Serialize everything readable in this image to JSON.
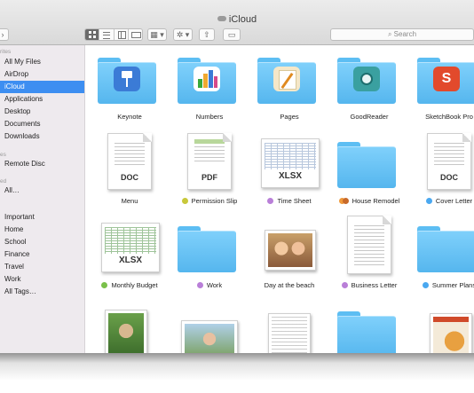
{
  "window": {
    "title": "iCloud"
  },
  "toolbar": {
    "search_placeholder": "Search"
  },
  "sidebar": {
    "favorites_heading": "rites",
    "favorites": [
      "All My Files",
      "AirDrop",
      "iCloud",
      "Applications",
      "Desktop",
      "Documents",
      "Downloads"
    ],
    "devices_heading": "es",
    "devices": [
      "Remote Disc"
    ],
    "shared_heading": "ed",
    "shared": [
      "All…"
    ],
    "tags_heading": "",
    "tags": [
      "Important",
      "Home",
      "School",
      "Finance",
      "Travel",
      "Work",
      "All Tags…"
    ],
    "selected": "iCloud"
  },
  "files": {
    "row1": [
      {
        "name": "Keynote",
        "kind": "folder",
        "app": "keynote",
        "color": "#3b7bd6"
      },
      {
        "name": "Numbers",
        "kind": "folder",
        "app": "numbers",
        "color": "#4caf50"
      },
      {
        "name": "Pages",
        "kind": "folder",
        "app": "pages",
        "color": "#f0a830"
      },
      {
        "name": "GoodReader",
        "kind": "folder",
        "app": "goodreader",
        "color": "#3aa0a0"
      },
      {
        "name": "SketchBook Pro",
        "kind": "folder",
        "app": "sketchbook",
        "color": "#e24a2c"
      }
    ],
    "row2": [
      {
        "name": "Menu",
        "kind": "doc",
        "type_label": "DOC",
        "tag": ""
      },
      {
        "name": "Permission Slip",
        "kind": "doc",
        "type_label": "PDF",
        "tag": "#c8c83a"
      },
      {
        "name": "Time Sheet",
        "kind": "sheet",
        "type_label": "XLSX",
        "tag": "#b97fd8"
      },
      {
        "name": "House Remodel",
        "kind": "folder",
        "tag": "#f09a3a",
        "tag2": "#e88a2a"
      },
      {
        "name": "Cover Letter",
        "kind": "doc",
        "type_label": "DOC",
        "tag": "#4aa8f0"
      }
    ],
    "row3": [
      {
        "name": "Monthly Budget",
        "kind": "sheet",
        "type_label": "XLSX",
        "tag": "#7ac04a"
      },
      {
        "name": "Work",
        "kind": "folder",
        "tag": "#b97fd8"
      },
      {
        "name": "Day at the beach",
        "kind": "photo",
        "tag": ""
      },
      {
        "name": "Business Letter",
        "kind": "doc",
        "type_label": "",
        "tag": "#b97fd8"
      },
      {
        "name": "Summer Plans",
        "kind": "folder",
        "tag": "#4aa8f0"
      }
    ]
  },
  "colors": {
    "sidebar_selection": "#3d8ef1",
    "folder": "#6cc6f7"
  }
}
